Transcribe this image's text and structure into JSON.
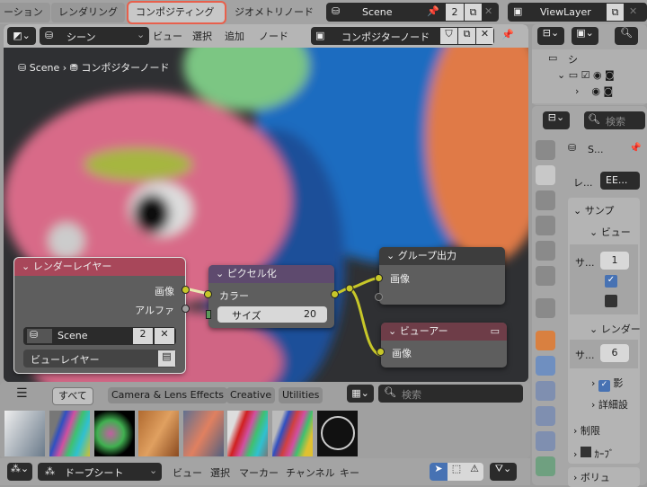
{
  "workspaces": [
    "ーション",
    "レンダリング",
    "コンポジティング",
    "ジオメトリノード"
  ],
  "active_workspace": "コンポジティング",
  "scene_selector": {
    "name": "Scene",
    "users": "2"
  },
  "viewlayer_selector": {
    "name": "ViewLayer"
  },
  "node_editor": {
    "header": {
      "scene_dropdown": "シーン",
      "menus": [
        "ビュー",
        "選択",
        "追加",
        "ノード"
      ],
      "node_tree": "コンポジターノード"
    },
    "breadcrumb": {
      "scene": "Scene",
      "tree": "コンポジターノード"
    },
    "nodes": {
      "render_layers": {
        "title": "レンダーレイヤー",
        "outputs": [
          "画像",
          "アルファ"
        ],
        "scene": "Scene",
        "scene_users": "2",
        "view_layer": "ビューレイヤー"
      },
      "pixelate": {
        "title": "ピクセル化",
        "input": "カラー",
        "size_label": "サイズ",
        "size_value": "20"
      },
      "group_output": {
        "title": "グループ出力",
        "input": "画像"
      },
      "viewer": {
        "title": "ビューアー",
        "input": "画像"
      }
    }
  },
  "asset_browser": {
    "tabs": [
      "すべて",
      "Camera & Lens Effects",
      "Creative",
      "Utilities"
    ],
    "active_tab": "すべて",
    "search_placeholder": "検索"
  },
  "dopesheet": {
    "mode": "ドープシート",
    "menus": [
      "ビュー",
      "選択",
      "マーカー",
      "チャンネル",
      "キー"
    ]
  },
  "outliner": {
    "row1": "シ"
  },
  "properties": {
    "search_placeholder": "検索",
    "scene_label": "S...",
    "render_engine_label": "レ...",
    "render_engine": "EE...",
    "sampling": "サンプ",
    "viewport": "ビュー",
    "viewport_samples_label": "サ...",
    "viewport_samples": "1",
    "render": "レンダー",
    "render_samples_label": "サ...",
    "render_samples": "6",
    "shadows": "影",
    "advanced": "詳細設",
    "limits": "制限",
    "curves": "ｶｰﾌﾞ",
    "volumes": "ボリュ"
  },
  "colors": {
    "accent": "#4772b3",
    "highlight_outline": "#e8604c",
    "socket_yellow": "#c7c729",
    "render_layer_header": "#a8475a",
    "pixelate_header": "#5e4a6e",
    "output_header": "#3d3d3d"
  }
}
